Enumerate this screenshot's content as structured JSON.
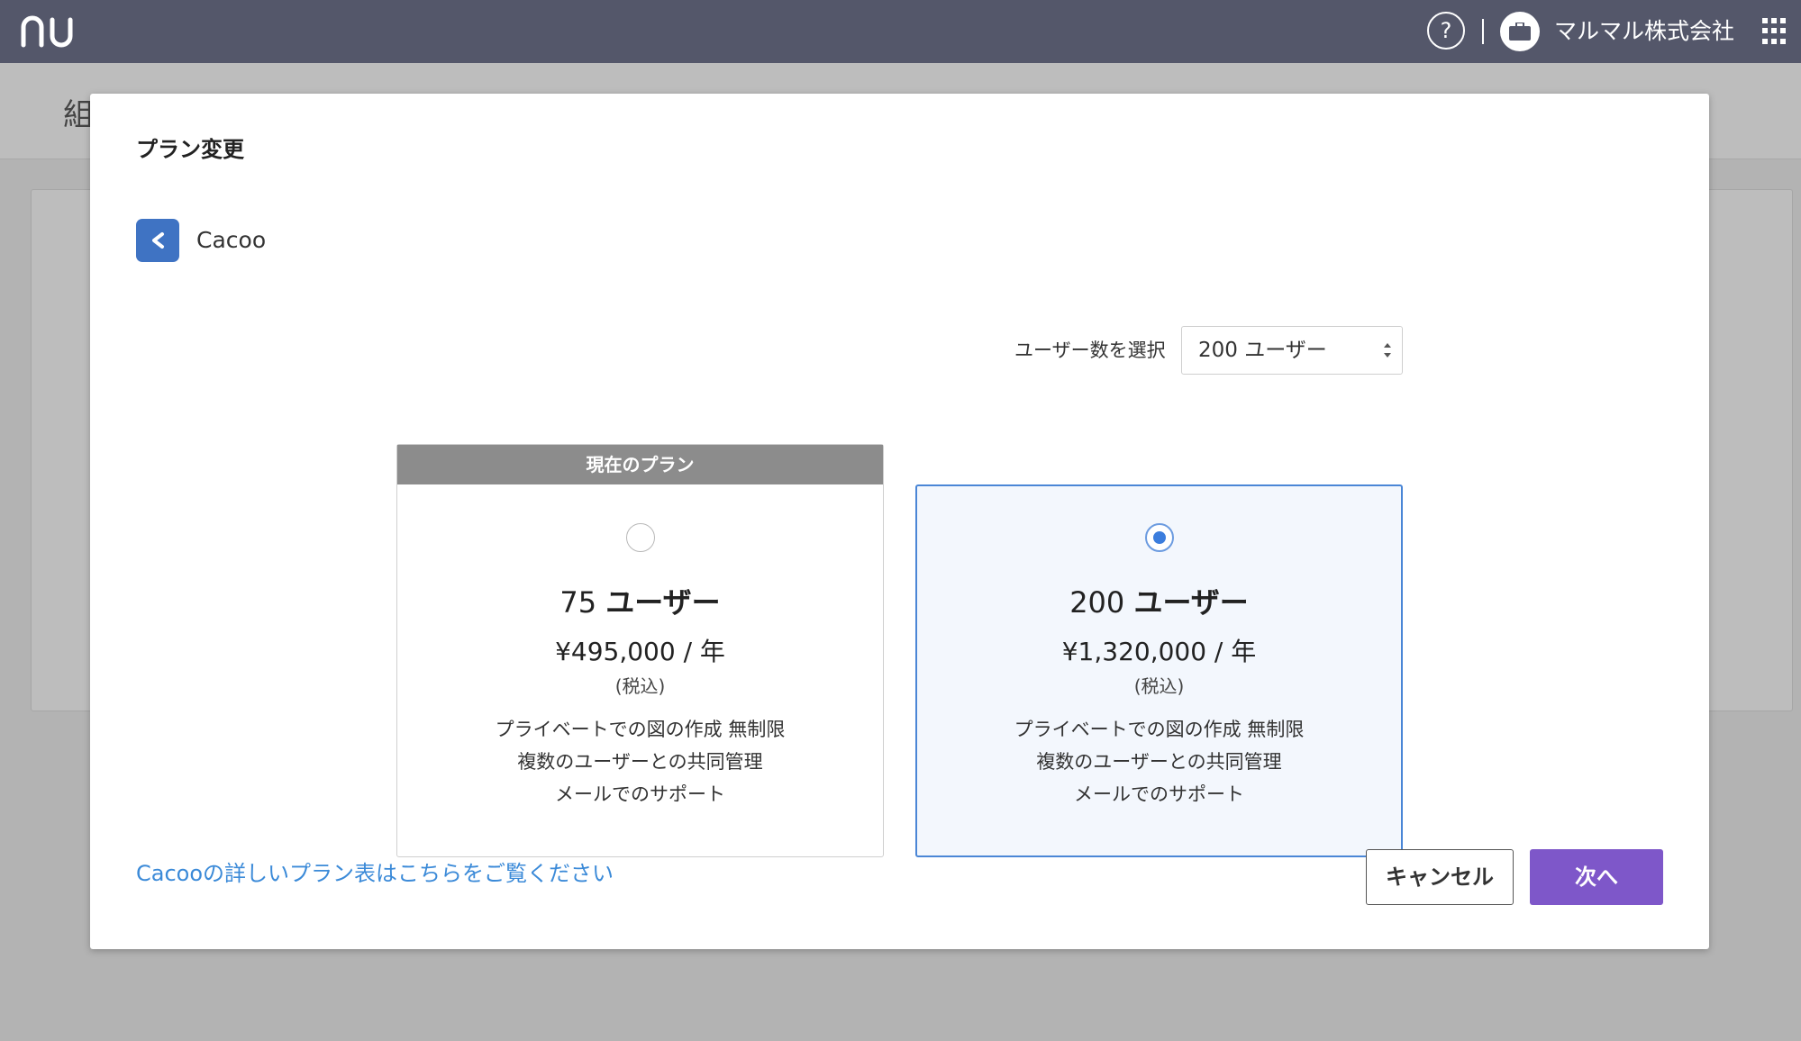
{
  "topbar": {
    "logo_text": "nu",
    "help_label": "?",
    "org_name": "マルマル株式会社"
  },
  "background": {
    "heading": "組"
  },
  "modal": {
    "title": "プラン変更",
    "app_name": "Cacoo",
    "user_select": {
      "label": "ユーザー数を選択",
      "value": "200 ユーザー"
    },
    "plans": [
      {
        "header": "現在のプラン",
        "selected": false,
        "users_num": "75",
        "users_unit": "ユーザー",
        "price": "¥495,000 / 年",
        "tax": "(税込)",
        "features": [
          "プライベートでの図の作成 無制限",
          "複数のユーザーとの共同管理",
          "メールでのサポート"
        ]
      },
      {
        "header": "",
        "selected": true,
        "users_num": "200",
        "users_unit": "ユーザー",
        "price": "¥1,320,000 / 年",
        "tax": "(税込)",
        "features": [
          "プライベートでの図の作成 無制限",
          "複数のユーザーとの共同管理",
          "メールでのサポート"
        ]
      }
    ],
    "plans_link": "Cacooの詳しいプラン表はこちらをご覧ください",
    "cancel_label": "キャンセル",
    "next_label": "次へ"
  },
  "colors": {
    "topbar": "#54576a",
    "accent_button": "#7e57c9",
    "selected_border": "#4a86d6",
    "link": "#3b8ad8",
    "app_icon": "#3f73c3"
  }
}
